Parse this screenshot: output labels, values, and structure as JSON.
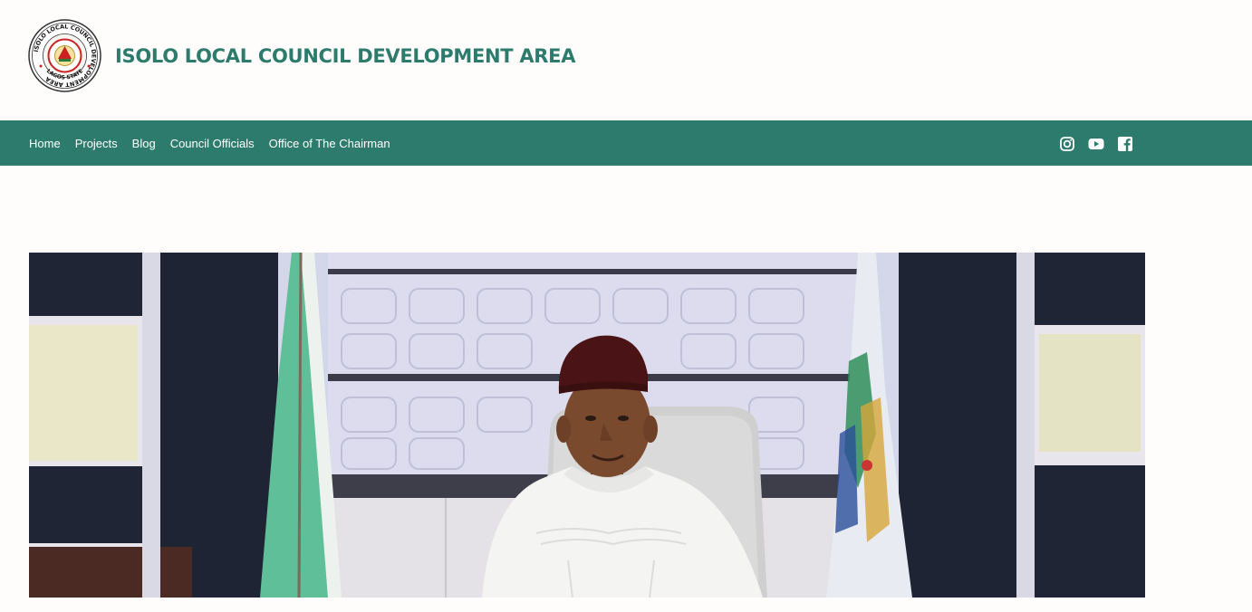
{
  "site": {
    "title": "ISOLO LOCAL COUNCIL DEVELOPMENT AREA",
    "logo_ring_text": "ISOLO LOCAL COUNCIL DEVELOPMENT AREA",
    "logo_bottom_text": "LAGOS STATE"
  },
  "nav": {
    "items": [
      {
        "label": "Home"
      },
      {
        "label": "Projects"
      },
      {
        "label": "Blog"
      },
      {
        "label": "Council Officials"
      },
      {
        "label": "Office of The Chairman"
      }
    ]
  },
  "social": {
    "icons": [
      "instagram-icon",
      "youtube-icon",
      "facebook-icon"
    ]
  },
  "colors": {
    "brand": "#2d7b6c",
    "background": "#fffdfc",
    "nav_text": "#ffffff"
  }
}
